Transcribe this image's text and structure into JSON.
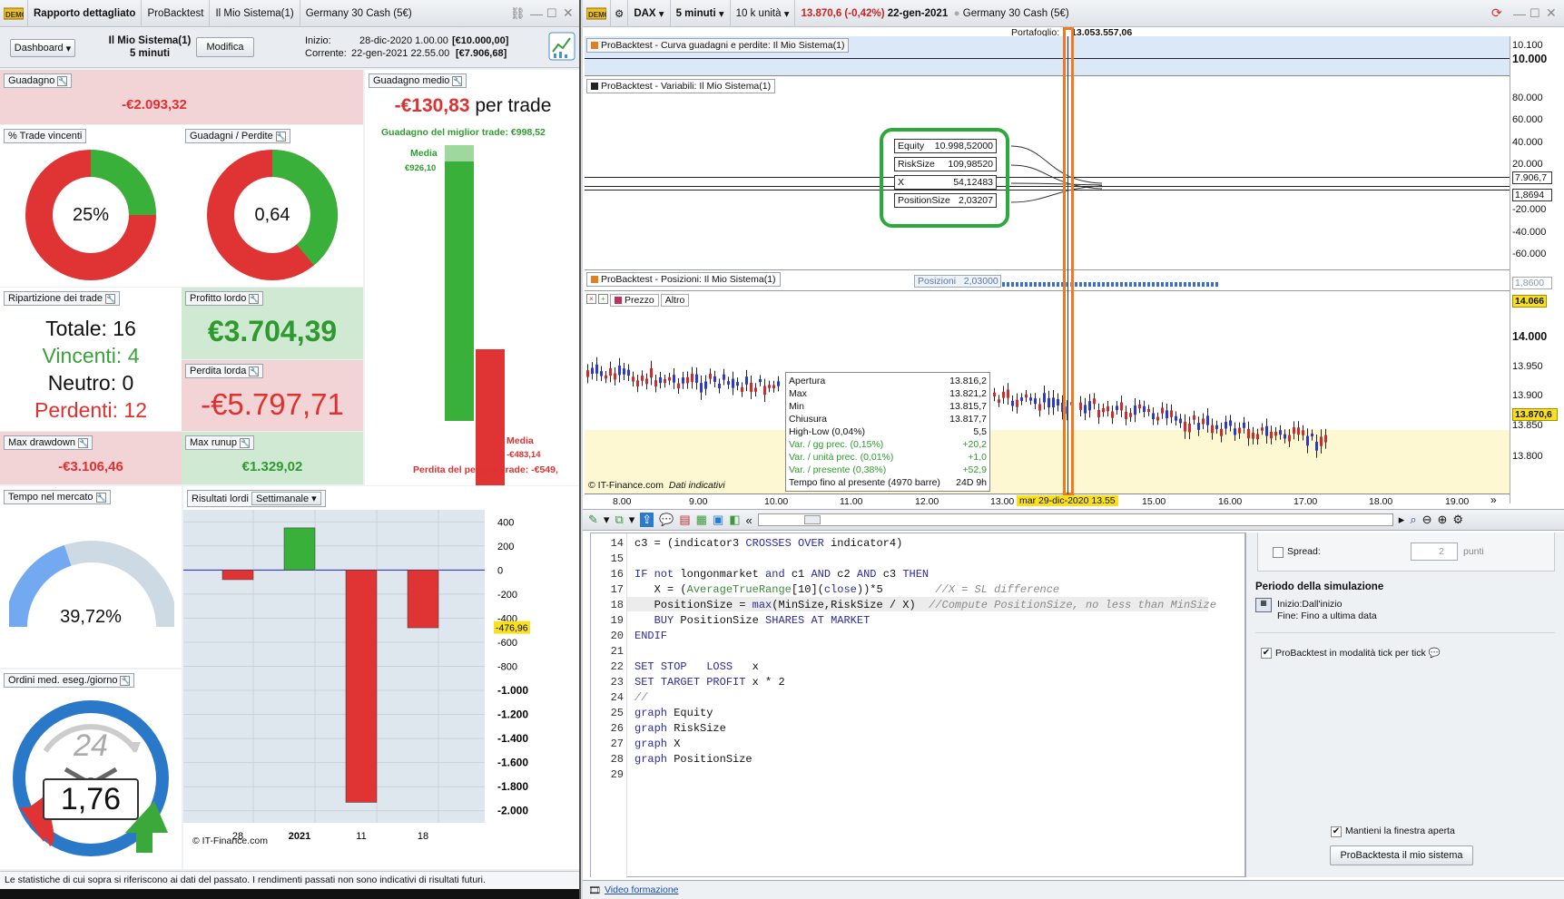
{
  "left": {
    "tabs": [
      "Rapporto dettagliato",
      "ProBacktest",
      "Il Mio Sistema(1)",
      "Germany 30 Cash (5€)"
    ],
    "toolbar": {
      "dashboard": "Dashboard",
      "system_name": "Il Mio Sistema(1)",
      "timeframe": "5 minuti",
      "modify": "Modifica",
      "start_label": "Inizio:",
      "start_value": "28-dic-2020 1.00.00",
      "start_capital": "[€10.000,00]",
      "current_label": "Corrente:",
      "current_value": "22-gen-2021 22.55.00",
      "current_capital": "[€7.906,68]"
    },
    "gain": {
      "label": "Guadagno",
      "value": "-€2.093,32"
    },
    "avg_gain": {
      "label": "Guadagno medio",
      "value": "-€130,83",
      "suffix": " per trade",
      "best": "Guadagno del miglior trade: €998,52",
      "worst": "Perdita del peggior trade: -€549,",
      "media_top": "Media",
      "media_top_val": "€926,10",
      "media_bot": "Media",
      "media_bot_val": "-€483,14"
    },
    "win_pct": {
      "label": "% Trade vincenti",
      "value": "25%",
      "fraction": 0.25
    },
    "gain_loss": {
      "label": "Guadagni / Perdite",
      "value": "0,64",
      "fraction": 0.39
    },
    "breakdown": {
      "label": "Ripartizione dei trade",
      "total": "Totale: 16",
      "winners": "Vincenti: 4",
      "neutral": "Neutro: 0",
      "losers": "Perdenti: 12"
    },
    "gross_profit": {
      "label": "Profitto lordo",
      "value": "€3.704,39"
    },
    "gross_loss": {
      "label": "Perdita lorda",
      "value": "-€5.797,71"
    },
    "max_drawdown": {
      "label": "Max drawdown",
      "value": "-€3.106,46"
    },
    "max_runup": {
      "label": "Max runup",
      "value": "€1.329,02"
    },
    "time_in_market": {
      "label": "Tempo nel mercato",
      "value": "39,72%",
      "fraction": 0.3972
    },
    "orders": {
      "label": "Ordini med. eseg./giorno",
      "value": "1,76",
      "clock": "24"
    },
    "gross_results": {
      "label": "Risultati lordi",
      "period": "Settimanale",
      "watermark": "© IT-Finance.com",
      "marker": "-476,96"
    },
    "footer": "Le statistiche di cui sopra si riferiscono ai dati del passato. I rendimenti passati non sono indicativi di risultati futuri."
  },
  "chart_data": {
    "type": "bar",
    "title": "Risultati lordi",
    "categories": [
      "28",
      "2021",
      "11",
      "18"
    ],
    "values": [
      -80,
      350,
      -1930,
      -480
    ],
    "ylim": [
      -2100,
      500
    ],
    "yticks": [
      "400",
      "200",
      "0",
      "-200",
      "-400",
      "-600",
      "-800",
      "-1.000",
      "-1.200",
      "-1.400",
      "-1.600",
      "-1.800",
      "-2.000"
    ],
    "ytick_values": [
      400,
      200,
      0,
      -200,
      -400,
      -600,
      -800,
      -1000,
      -1200,
      -1400,
      -1600,
      -1800,
      -2000
    ]
  },
  "right": {
    "toolbar": {
      "instrument": "DAX",
      "timeframe": "5 minuti",
      "units": "10 k unità",
      "price": "13.870,6 (-0,42%)",
      "date": "22-gen-2021",
      "market": "Germany 30 Cash (5€)"
    },
    "portfolio": "Portafoglio:",
    "portfolio_value": "13.053.557,06",
    "equity_curve_label": "ProBacktest - Curva guadagni e perdite: Il Mio Sistema(1)",
    "equity_axis": [
      "10.100",
      "10.000"
    ],
    "variables_label": "ProBacktest - Variabili: Il Mio Sistema(1)",
    "variables_axis": [
      "80.000",
      "60.000",
      "40.000",
      "20.000",
      "-20.000",
      "-40.000",
      "-60.000"
    ],
    "variables_badges": [
      "7.906,7",
      "1,8694"
    ],
    "tooltip": [
      {
        "name": "Equity",
        "value": "10.998,52000"
      },
      {
        "name": "RiskSize",
        "value": "109,98520"
      },
      {
        "name": "X",
        "value": "54,12483"
      },
      {
        "name": "PositionSize",
        "value": "2,03207"
      }
    ],
    "positions_label": "ProBacktest - Posizioni: Il Mio Sistema(1)",
    "positions_value_label": "Posizioni",
    "positions_value": "2,03000",
    "positions_badge": "1,8600",
    "price_label": "Prezzo",
    "price_other": "Altro",
    "price_axis": [
      "14.066",
      "14.000",
      "13.950",
      "13.900",
      "13.870,6",
      "13.850",
      "13.800"
    ],
    "ohlc": [
      {
        "k": "Apertura",
        "v": "13.816,2"
      },
      {
        "k": "Max",
        "v": "13.821,2"
      },
      {
        "k": "Min",
        "v": "13.815,7"
      },
      {
        "k": "Chiusura",
        "v": "13.817,7"
      },
      {
        "k": "High-Low (0,04%)",
        "v": "5,5"
      },
      {
        "k": "Var. / gg prec. (0,15%)",
        "v": "+20,2"
      },
      {
        "k": "Var. / unità prec. (0,01%)",
        "v": "+1,0"
      },
      {
        "k": "Var. / presente (0,38%)",
        "v": "+52,9"
      },
      {
        "k": "Tempo fino al presente (4970 barre)",
        "v": "24D 9h"
      }
    ],
    "watermark": "© IT-Finance.com",
    "watermark2": "Dati indicativi",
    "xaxis": [
      "8.00",
      "9.00",
      "10.00",
      "11.00",
      "12.00",
      "13.00",
      "15.00",
      "16.00",
      "17.00",
      "18.00",
      "19.00"
    ],
    "cursor_date": "mar 29-dic-2020 13.55",
    "code": [
      {
        "n": "14",
        "t": "c3 = (indicator3 CROSSES OVER indicator4)"
      },
      {
        "n": "15",
        "t": ""
      },
      {
        "n": "16",
        "t": "IF not longonmarket and c1 AND c2 AND c3 THEN"
      },
      {
        "n": "17",
        "t": "   X = (AverageTrueRange[10](close))*5        //X = SL difference"
      },
      {
        "n": "18",
        "t": "   PositionSize = max(MinSize,RiskSize / X)  //Compute PositionSize, no less than MinSize"
      },
      {
        "n": "19",
        "t": "   BUY PositionSize SHARES AT MARKET"
      },
      {
        "n": "20",
        "t": "ENDIF"
      },
      {
        "n": "21",
        "t": ""
      },
      {
        "n": "22",
        "t": "SET STOP   LOSS   x"
      },
      {
        "n": "23",
        "t": "SET TARGET PROFIT x * 2"
      },
      {
        "n": "24",
        "t": "//"
      },
      {
        "n": "25",
        "t": "graph Equity"
      },
      {
        "n": "26",
        "t": "graph RiskSize"
      },
      {
        "n": "27",
        "t": "graph X"
      },
      {
        "n": "28",
        "t": "graph PositionSize"
      },
      {
        "n": "29",
        "t": ""
      }
    ],
    "settings": {
      "spread_label": "Spread:",
      "spread_value": "2",
      "spread_unit": "punti",
      "period_title": "Periodo della simulazione",
      "start": "Inizio:Dall'inizio",
      "end": "Fine: Fino a ultima data",
      "tick_mode": "ProBacktest in modalità tick per tick",
      "keep_open": "Mantieni la finestra aperta",
      "run_button": "ProBacktesta il mio sistema"
    },
    "video_link": "Video formazione"
  }
}
